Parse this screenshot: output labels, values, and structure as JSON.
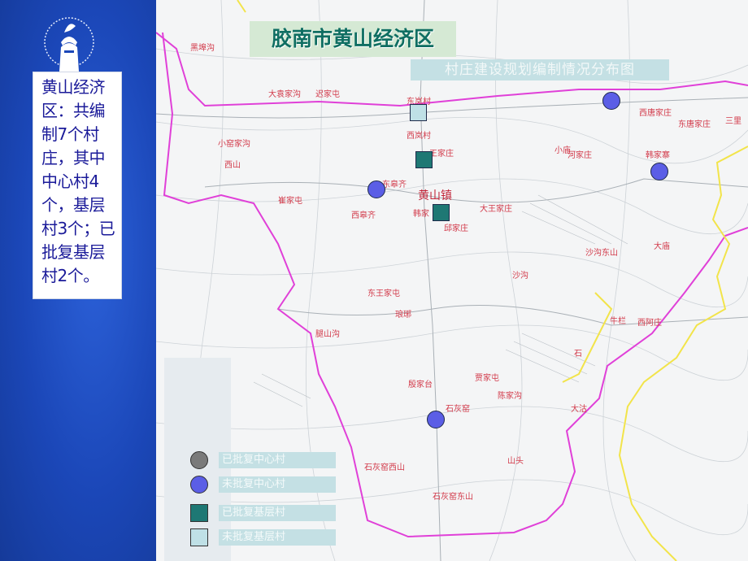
{
  "sidebar": {
    "description": "黄山经济区：共编制7个村庄，其中中心村4个，基层村3个；已批复基层村2个。"
  },
  "map": {
    "title": "胶南市黄山经济区",
    "subtitle": "村庄建设规划编制情况分布图",
    "places": [
      "黑埠沟",
      "大袁家沟",
      "迟家屯",
      "东岚村",
      "西岚村",
      "王家庄",
      "小窑家沟",
      "崔家屯",
      "黄山镇",
      "韩家",
      "西皋齐",
      "东皋齐",
      "大王家庄",
      "邱家庄",
      "东王家屯",
      "琅琊",
      "贾家屯",
      "腿山沟",
      "殷家台",
      "石灰窑",
      "陈家沟",
      "大沽",
      "石灰窑西山",
      "石灰窑东山",
      "山头",
      "三里",
      "韩家寨",
      "西山",
      "大庙",
      "小庙",
      "河家庄",
      "西唐家庄",
      "东唐家庄",
      "沙沟",
      "沙沟东山",
      "石",
      "牛栏",
      "西阿庄"
    ],
    "legend": [
      {
        "label": "已批复中心村",
        "symbol": "circle-gray"
      },
      {
        "label": "未批复中心村",
        "symbol": "circle-blue"
      },
      {
        "label": "已批复基层村",
        "symbol": "square-teal"
      },
      {
        "label": "未批复基层村",
        "symbol": "square-lightblue"
      }
    ],
    "colors": {
      "boundary": "#e040d8",
      "region_border": "#f2e44a",
      "center_blue": "#5b5ee6",
      "teal": "#1e7874",
      "light": "#bfe0e6"
    }
  }
}
